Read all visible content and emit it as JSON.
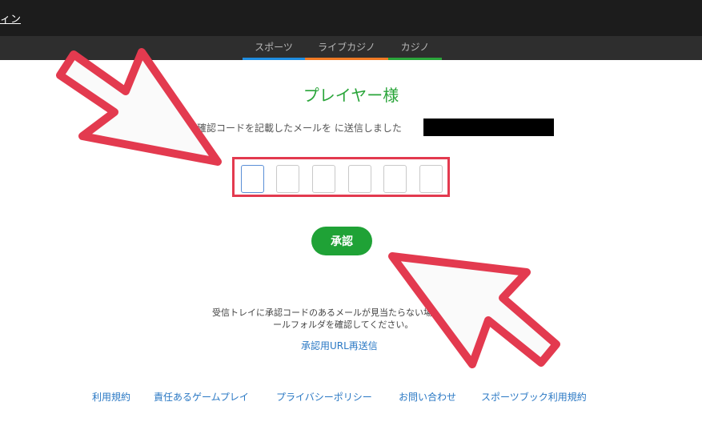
{
  "header": {
    "login_label": "ィン"
  },
  "nav": {
    "tabs": [
      {
        "label": "スポーツ",
        "accent": "#1f8de0"
      },
      {
        "label": "ライブカジノ",
        "accent": "#f07a24"
      },
      {
        "label": "カジノ",
        "accent": "#2aa53a"
      }
    ]
  },
  "verify": {
    "title": "プレイヤー様",
    "sent_message": "ト確認コードを記載したメールを に送信しました",
    "code_digits": [
      "",
      "",
      "",
      "",
      "",
      ""
    ],
    "approve_label": "承認",
    "help_line1": "受信トレイに承認コードのあるメールが見当たらない場",
    "help_line2": "ールフォルダを確認してください。",
    "resend_label": "承認用URL再送信"
  },
  "footer": {
    "links": [
      "利用規約",
      "責任あるゲームプレイ",
      "プライバシーポリシー",
      "お問い合わせ",
      "スポーツブック利用規約"
    ]
  },
  "colors": {
    "brand_green": "#2aa53a",
    "annotation_red": "#e33a4f",
    "link_blue": "#2a78c4"
  }
}
